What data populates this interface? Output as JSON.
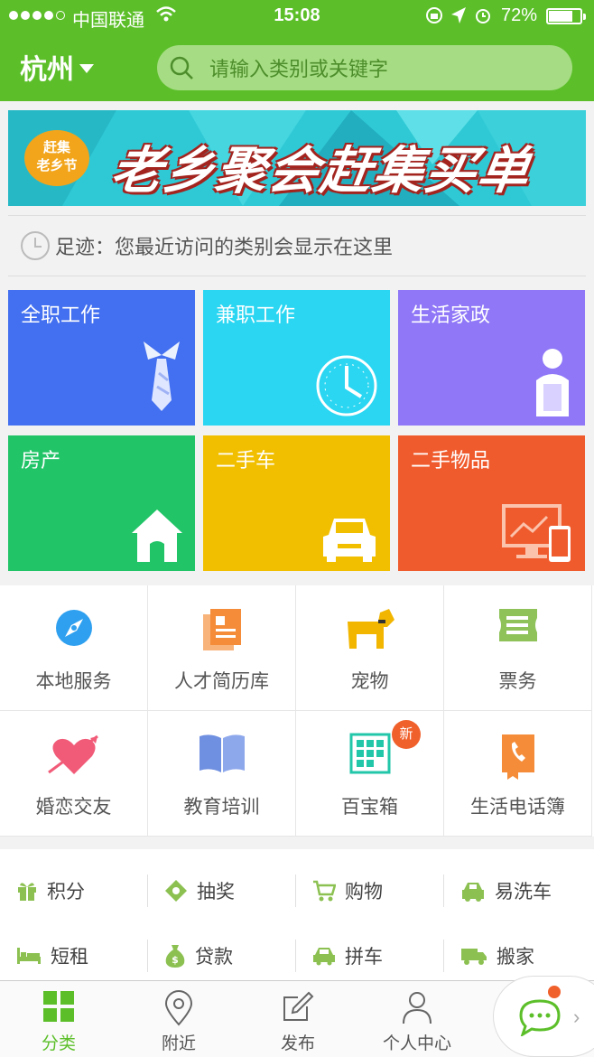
{
  "status_bar": {
    "carrier": "中国联通",
    "time": "15:08",
    "battery": "72%",
    "battery_level": 0.72
  },
  "header": {
    "city": "杭州",
    "search_placeholder": "请输入类别或关键字"
  },
  "banner": {
    "badge_line1": "赶集",
    "badge_line2": "老乡节",
    "headline": "老乡聚会赶集买单"
  },
  "footprint": {
    "text": "足迹：您最近访问的类别会显示在这里"
  },
  "tiles": [
    {
      "label": "全职工作",
      "color": "#4370f0",
      "icon": "necktie-icon"
    },
    {
      "label": "兼职工作",
      "color": "#2ad6f2",
      "icon": "clock-icon"
    },
    {
      "label": "生活家政",
      "color": "#8f77f7",
      "icon": "housekeeper-icon"
    },
    {
      "label": "房产",
      "color": "#22c468",
      "icon": "house-icon"
    },
    {
      "label": "二手车",
      "color": "#f1bf00",
      "icon": "car-icon"
    },
    {
      "label": "二手物品",
      "color": "#f05b2d",
      "icon": "computer-phone-icon"
    }
  ],
  "grid": [
    {
      "label": "本地服务",
      "icon": "compass-icon",
      "color": "#2fa0ef"
    },
    {
      "label": "人才简历库",
      "icon": "resume-icon",
      "color": "#f58c3a"
    },
    {
      "label": "宠物",
      "icon": "dog-icon",
      "color": "#f2b600"
    },
    {
      "label": "票务",
      "icon": "ticket-icon",
      "color": "#8fc35a"
    },
    {
      "label": "婚恋交友",
      "icon": "heart-arrow-icon",
      "color": "#f15b78"
    },
    {
      "label": "教育培训",
      "icon": "book-icon",
      "color": "#6f8fe0"
    },
    {
      "label": "百宝箱",
      "icon": "toolbox-icon",
      "color": "#22c6a8",
      "badge": "新"
    },
    {
      "label": "生活电话簿",
      "icon": "phonebook-icon",
      "color": "#f58c3a"
    }
  ],
  "services": [
    {
      "label": "积分",
      "icon": "gift-icon"
    },
    {
      "label": "抽奖",
      "icon": "lottery-icon"
    },
    {
      "label": "购物",
      "icon": "cart-icon"
    },
    {
      "label": "易洗车",
      "icon": "carwash-icon"
    },
    {
      "label": "短租",
      "icon": "bed-icon"
    },
    {
      "label": "贷款",
      "icon": "moneybag-icon"
    },
    {
      "label": "拼车",
      "icon": "carpool-icon"
    },
    {
      "label": "搬家",
      "icon": "truck-icon"
    }
  ],
  "tabbar": [
    {
      "label": "分类",
      "icon": "grid-icon",
      "active": true
    },
    {
      "label": "附近",
      "icon": "location-pin-icon"
    },
    {
      "label": "发布",
      "icon": "edit-icon"
    },
    {
      "label": "个人中心",
      "icon": "person-icon"
    }
  ],
  "colors": {
    "brand_green": "#5cbf2a",
    "badge_orange": "#f0602b"
  }
}
